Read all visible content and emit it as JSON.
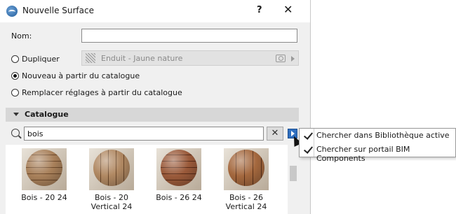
{
  "window": {
    "title": "Nouvelle Surface",
    "help_label": "?",
    "close_label": "✕"
  },
  "form": {
    "name_label": "Nom:",
    "name_value": "",
    "options": [
      {
        "label": "Dupliquer",
        "checked": false
      },
      {
        "label": "Nouveau à partir du catalogue",
        "checked": true
      },
      {
        "label": "Remplacer réglages à partir du catalogue",
        "checked": false
      }
    ],
    "duplicate_source": "Enduit - Jaune nature"
  },
  "catalogue": {
    "header": "Catalogue",
    "search_value": "bois",
    "clear_label": "✕",
    "materials": [
      {
        "name": "Bois - 20 24",
        "icon": "wood-horizontal-sphere"
      },
      {
        "name": "Bois - 20 Vertical 24",
        "icon": "wood-vertical-sphere"
      },
      {
        "name": "Bois - 26 24",
        "icon": "wood-dark-sphere"
      },
      {
        "name": "Bois - 26 Vertical 24",
        "icon": "wood-dark-vertical-sphere"
      }
    ]
  },
  "search_menu": {
    "items": [
      {
        "label": "Chercher dans Bibliothèque active",
        "checked": true
      },
      {
        "label": "Chercher sur portail BIM Components",
        "checked": true
      }
    ]
  }
}
